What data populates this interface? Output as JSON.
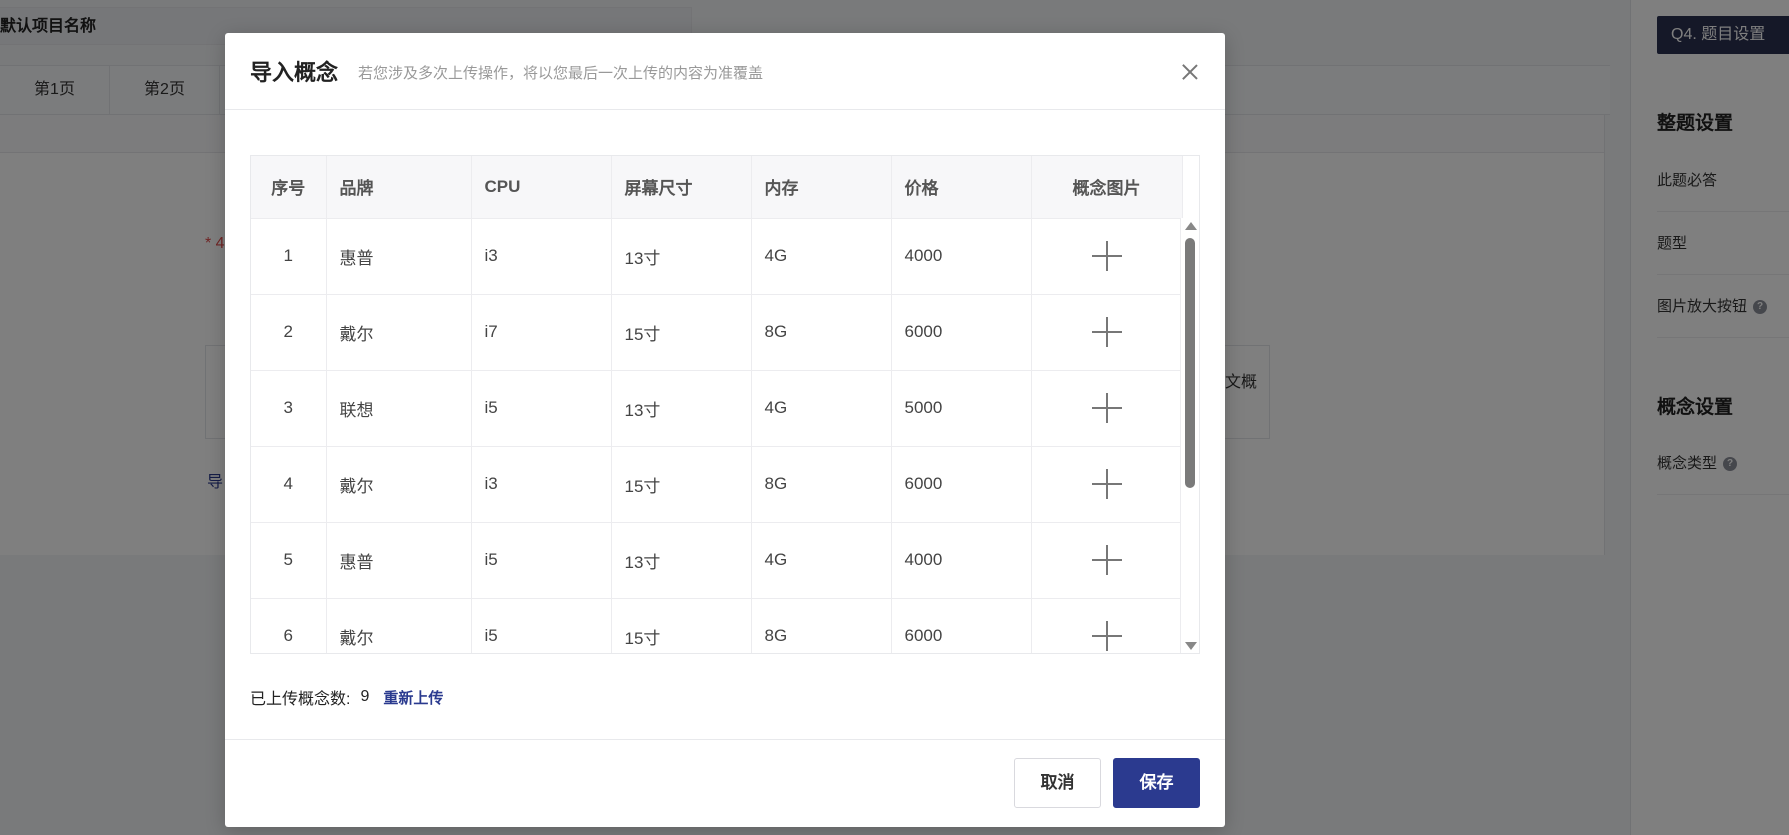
{
  "background": {
    "project_name": "默认项目名称",
    "page_tabs": [
      "第1页",
      "第2页"
    ],
    "required_mark": "* 4",
    "box_text": "文概",
    "link_text": "导"
  },
  "right_panel": {
    "button_label": "Q4. 题目设置",
    "section1_title": "整题设置",
    "items1": [
      "此题必答",
      "题型",
      "图片放大按钮"
    ],
    "section2_title": "概念设置",
    "items2": [
      "概念类型"
    ]
  },
  "modal": {
    "title": "导入概念",
    "subtitle": "若您涉及多次上传操作，将以您最后一次上传的内容为准覆盖",
    "table": {
      "headers": [
        "序号",
        "品牌",
        "CPU",
        "屏幕尺寸",
        "内存",
        "价格",
        "概念图片"
      ],
      "rows": [
        [
          "1",
          "惠普",
          "i3",
          "13寸",
          "4G",
          "4000"
        ],
        [
          "2",
          "戴尔",
          "i7",
          "15寸",
          "8G",
          "6000"
        ],
        [
          "3",
          "联想",
          "i5",
          "13寸",
          "4G",
          "5000"
        ],
        [
          "4",
          "戴尔",
          "i3",
          "15寸",
          "8G",
          "6000"
        ],
        [
          "5",
          "惠普",
          "i5",
          "13寸",
          "4G",
          "4000"
        ],
        [
          "6",
          "戴尔",
          "i5",
          "15寸",
          "8G",
          "6000"
        ]
      ]
    },
    "upload_label": "已上传概念数:",
    "upload_count": "9",
    "reupload_label": "重新上传",
    "cancel_label": "取消",
    "save_label": "保存"
  },
  "colors": {
    "primary": "#2b3a8f",
    "panel_button": "#2b3050",
    "required": "#e14b4b"
  }
}
